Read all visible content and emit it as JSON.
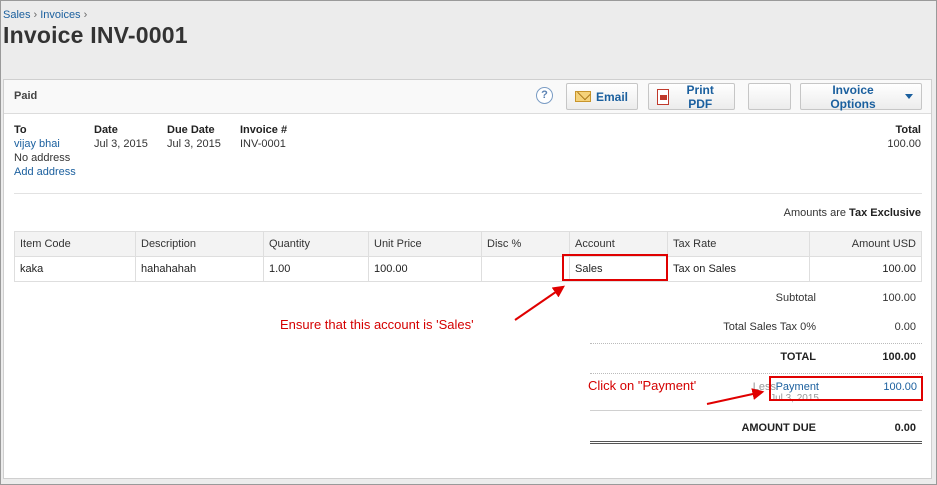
{
  "breadcrumb": {
    "items": [
      "Sales",
      "Invoices"
    ]
  },
  "page_title": "Invoice INV-0001",
  "toolbar": {
    "status": "Paid",
    "help_label": "?",
    "email_label": "Email",
    "print_pdf_label": "Print PDF",
    "blank_label": "",
    "invoice_options_label": "Invoice Options"
  },
  "header": {
    "to_label": "To",
    "to_name": "vijay bhai",
    "to_address": "No address",
    "add_address_label": "Add address",
    "date_label": "Date",
    "date_value": "Jul 3, 2015",
    "due_date_label": "Due Date",
    "due_date_value": "Jul 3, 2015",
    "invoice_no_label": "Invoice #",
    "invoice_no_value": "INV-0001",
    "total_label": "Total",
    "total_value": "100.00"
  },
  "amounts_are_label": "Amounts are",
  "amounts_are_value": "Tax Exclusive",
  "line_table": {
    "columns": [
      "Item Code",
      "Description",
      "Quantity",
      "Unit Price",
      "Disc %",
      "Account",
      "Tax Rate",
      "Amount USD"
    ],
    "rows": [
      {
        "item_code": "kaka",
        "description": "hahahahah",
        "quantity": "1.00",
        "unit_price": "100.00",
        "disc": "",
        "account": "Sales",
        "tax_rate": "Tax on Sales",
        "amount": "100.00"
      }
    ]
  },
  "totals": {
    "subtotal_label": "Subtotal",
    "subtotal_value": "100.00",
    "tax_label": "Total Sales Tax 0%",
    "tax_value": "0.00",
    "total_label": "TOTAL",
    "total_value": "100.00",
    "less_label": "Less",
    "payment_label": "Payment",
    "payment_date": "Jul 3, 2015",
    "payment_value": "100.00",
    "amount_due_label": "AMOUNT DUE",
    "amount_due_value": "0.00"
  },
  "annotations": {
    "account_note": "Ensure that this account is 'Sales'",
    "payment_note": "Click on \"Payment'"
  },
  "colors": {
    "link": "#1a5f9e",
    "annotation": "#e00000"
  }
}
